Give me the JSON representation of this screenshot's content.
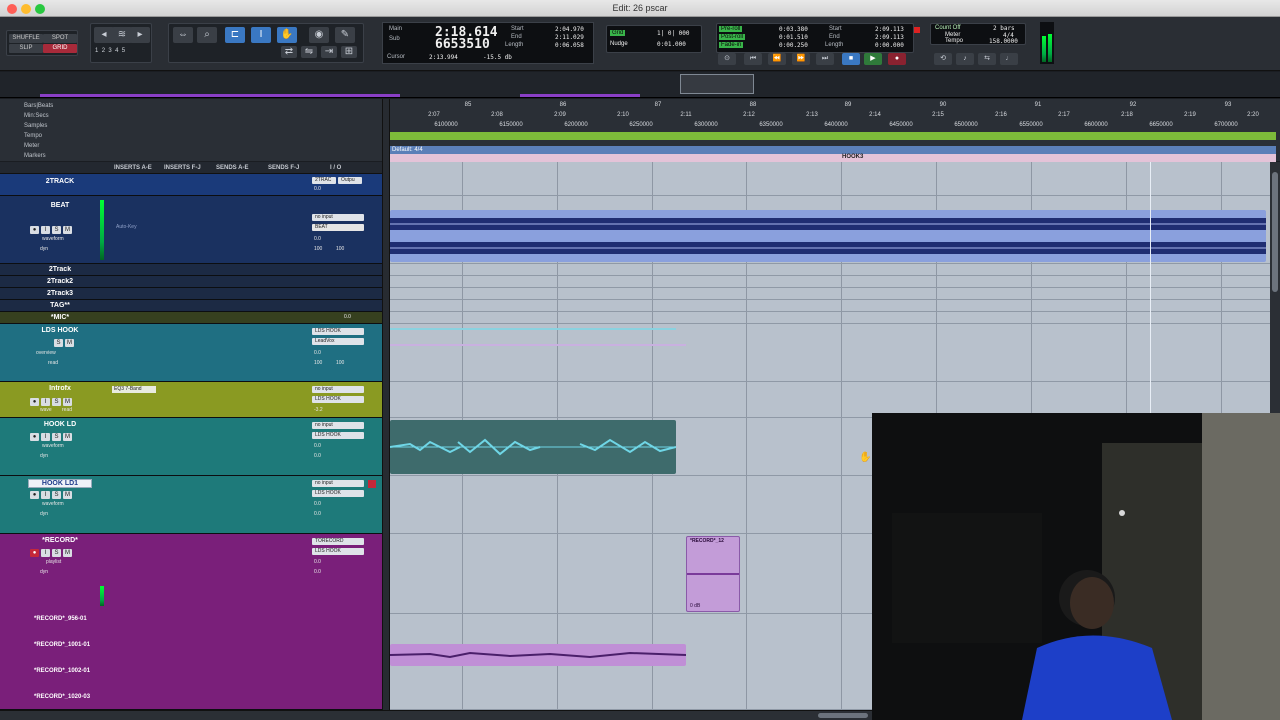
{
  "window": {
    "title": "Edit: 26 pscar"
  },
  "toolbar": {
    "modes": [
      "SHUFFLE",
      "SPOT",
      "SLIP",
      "GRID"
    ],
    "zoom_presets": [
      "1",
      "2",
      "3",
      "4",
      "5"
    ],
    "main_counter": {
      "main_label": "Main",
      "main_value": "2:18.614",
      "sub_label": "Sub",
      "sub_value": "6653510",
      "cursor_label": "Cursor",
      "cursor_value": "2:13.994",
      "cursor_db": "-15.5 db"
    },
    "selection": {
      "start_label": "Start",
      "end_label": "End",
      "length_label": "Length",
      "start": "2:04.970",
      "end": "2:11.029",
      "length": "0:06.058"
    },
    "grid": {
      "label": "Grid",
      "value": "1| 0| 000",
      "nudge_label": "Nudge",
      "nudge_value": "0:01.000"
    },
    "preroll": {
      "preroll_label": "Pre-roll",
      "postroll_label": "Post-roll",
      "fadein_label": "Fade-in",
      "preroll": "0:03.380",
      "postroll": "0:01.510",
      "fadein": "0:00.250",
      "length_value": "0:00.000",
      "start2": "2:09.113",
      "end2": "2:09.113"
    },
    "count": {
      "countoff_label": "Count Off",
      "meter_label": "Meter",
      "tempo_label": "Tempo",
      "bars": "2 bars",
      "meter": "4/4",
      "tempo": "158.0000"
    }
  },
  "rulers": {
    "names": [
      "Bars|Beats",
      "Min:Secs",
      "Samples",
      "Tempo",
      "Meter",
      "Markers"
    ],
    "bars": [
      "85",
      "86",
      "87",
      "88",
      "89",
      "90",
      "91",
      "92",
      "93"
    ],
    "minsecs": [
      "2:07",
      "2:08",
      "2:09",
      "2:10",
      "2:11",
      "2:12",
      "2:13",
      "2:14",
      "2:15",
      "2:16",
      "2:17",
      "2:18",
      "2:19",
      "2:20"
    ],
    "samples": [
      "6100000",
      "6150000",
      "6200000",
      "6250000",
      "6300000",
      "6350000",
      "6400000",
      "6450000",
      "6500000",
      "6550000",
      "6600000",
      "6650000",
      "6700000"
    ],
    "meter_text": "Default: 4/4",
    "marker_text": "HOOK3"
  },
  "column_heads": [
    "INSERTS A-E",
    "INSERTS F-J",
    "SENDS A-E",
    "SENDS F-J",
    "I / O"
  ],
  "tracks": [
    {
      "name": "2TRACK",
      "io_top": "2TRAC",
      "io_out": "Outpu",
      "vol": "0.0",
      "view": "",
      "auto": ""
    },
    {
      "name": "BEAT",
      "io_top": "no input",
      "io_out": "BEAT",
      "vol": "0.0",
      "view": "waveform",
      "auto": "dyn",
      "insert": "Auto-Key",
      "pan": "100",
      "pan2": "100"
    },
    {
      "name": "2Track",
      "io_top": "",
      "io_out": "",
      "vol": "",
      "view": "",
      "auto": ""
    },
    {
      "name": "2Track2",
      "io_top": "",
      "io_out": "",
      "vol": "",
      "view": "",
      "auto": ""
    },
    {
      "name": "2Track3",
      "io_top": "",
      "io_out": "",
      "vol": "",
      "view": "",
      "auto": ""
    },
    {
      "name": "TAG**",
      "io_top": "",
      "io_out": "",
      "vol": "",
      "view": "",
      "auto": ""
    },
    {
      "name": "*MIC*",
      "io_top": "",
      "io_out": "",
      "vol": "0.0",
      "view": "",
      "auto": ""
    },
    {
      "name": "LDS HOOK",
      "io_top": "LDS HOOK",
      "io_out": "LeadVox",
      "vol": "0.0",
      "view": "overview",
      "auto": "read",
      "pan": "100",
      "pan2": "100"
    },
    {
      "name": "Introfx",
      "io_top": "no input",
      "io_out": "LDS HOOK",
      "vol": "-3.2",
      "view": "wave",
      "auto": "read",
      "insert": "EQ3 7-Band"
    },
    {
      "name": "HOOK LD",
      "io_top": "no input",
      "io_out": "LDS HOOK",
      "vol": "0.0",
      "view": "waveform",
      "auto": "dyn",
      "pan": "0.0"
    },
    {
      "name": "HOOK LD1",
      "io_top": "no input",
      "io_out": "LDS HOOK",
      "vol": "0.0",
      "view": "waveform",
      "auto": "dyn",
      "pan": "0.0"
    },
    {
      "name": "*RECORD*",
      "io_top": "TORECORD",
      "io_out": "LDS HOOK",
      "vol": "0.0",
      "view": "playlist",
      "auto": "dyn",
      "pan": "0.0"
    }
  ],
  "sub_tracks": [
    "*RECORD*_956-01",
    "*RECORD*_1001-01",
    "*RECORD*_1002-01",
    "*RECORD*_1020-03"
  ],
  "clips": {
    "record_clip_name": "*RECORD*_12",
    "record_clip_gain": "0 dB"
  },
  "colors": {
    "beat_track": "#2f3a7a",
    "lds_hook": "#2a9ab0",
    "introfx": "#9aa82a",
    "hook_ld": "#2a8c8c",
    "record": "#8a2a8a",
    "waveform_blue": "#1f2d72",
    "vocal_cyan": "#6fd6e6",
    "purple_clip": "#c08fd6"
  }
}
